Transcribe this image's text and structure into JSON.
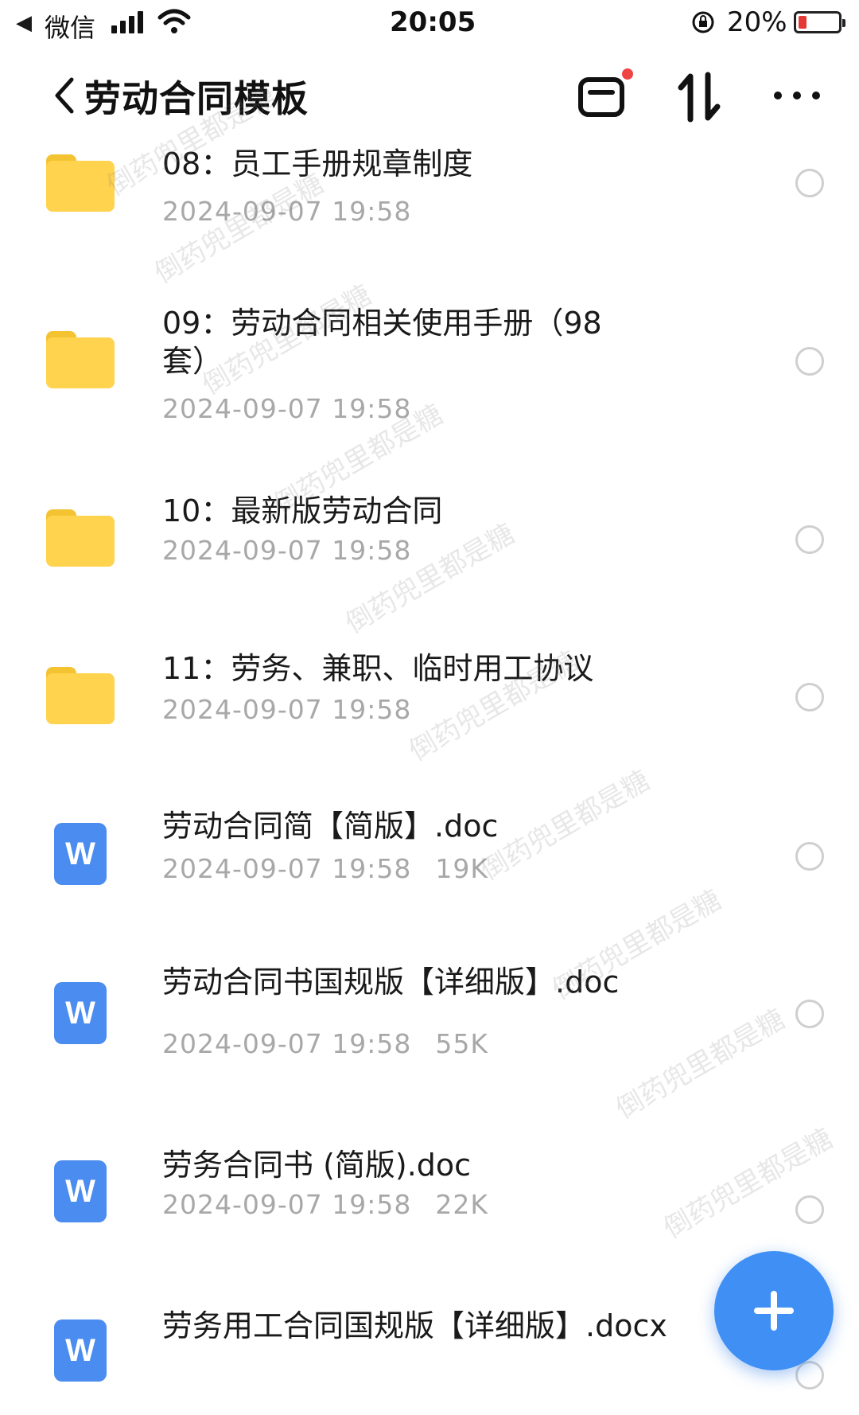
{
  "status_bar": {
    "carrier": "微信",
    "time": "20:05",
    "battery_percent": "20%",
    "battery_level": 0.2,
    "battery_color": "#e53935"
  },
  "header": {
    "title": "劳动合同模板",
    "notification_dot_color": "#ef4444"
  },
  "colors": {
    "folder": "#ffd34d",
    "folder_tab": "#f4c332",
    "doc": "#4a8cf0",
    "fab": "#3f8ff5"
  },
  "files": [
    {
      "type": "folder",
      "name": "08：员工手册规章制度",
      "date": "2024-09-07 19:58",
      "size": ""
    },
    {
      "type": "folder",
      "name": "09：劳动合同相关使用手册（98套）",
      "date": "2024-09-07 19:58",
      "size": ""
    },
    {
      "type": "folder",
      "name": "10：最新版劳动合同",
      "date": "2024-09-07 19:58",
      "size": ""
    },
    {
      "type": "folder",
      "name": "11：劳务、兼职、临时用工协议",
      "date": "2024-09-07 19:58",
      "size": ""
    },
    {
      "type": "doc",
      "icon_letter": "W",
      "name": "劳动合同简【简版】.doc",
      "date": "2024-09-07 19:58",
      "size": "19K"
    },
    {
      "type": "doc",
      "icon_letter": "W",
      "name": "劳动合同书国规版【详细版】.doc",
      "date": "2024-09-07 19:58",
      "size": "55K"
    },
    {
      "type": "doc",
      "icon_letter": "W",
      "name": "劳务合同书 (简版).doc",
      "date": "2024-09-07 19:58",
      "size": "22K"
    },
    {
      "type": "doc",
      "icon_letter": "W",
      "name": "劳务用工合同国规版【详细版】.docx",
      "date": "",
      "size": ""
    }
  ],
  "watermark": "倒药兜里都是糖"
}
